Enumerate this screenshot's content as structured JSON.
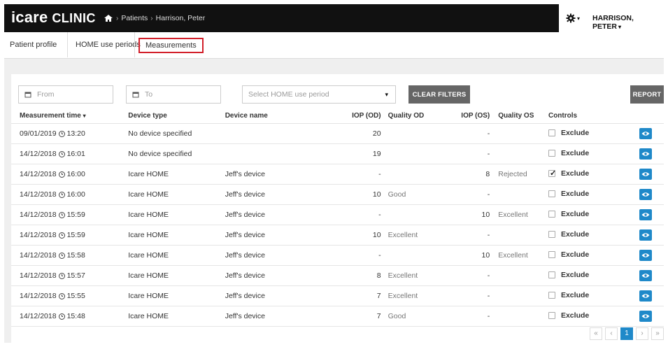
{
  "brand": {
    "part1": "icare",
    "part2": "CLINIC"
  },
  "breadcrumb": {
    "items": [
      "Patients",
      "Harrison, Peter"
    ],
    "separator": "›"
  },
  "user": {
    "name": "HARRISON, PETER"
  },
  "tabs": [
    "Patient profile",
    "HOME use periods",
    "Measurements"
  ],
  "filters": {
    "from_placeholder": "From",
    "to_placeholder": "To",
    "period_placeholder": "Select HOME use period",
    "clear_label": "CLEAR FILTERS",
    "report_label": "REPORT"
  },
  "table": {
    "headers": {
      "time": "Measurement time",
      "device_type": "Device type",
      "device_name": "Device name",
      "iop_od": "IOP (OD)",
      "quality_od": "Quality OD",
      "iop_os": "IOP (OS)",
      "quality_os": "Quality OS",
      "controls": "Controls"
    },
    "exclude_label": "Exclude",
    "rows": [
      {
        "date": "09/01/2019",
        "time": "13:20",
        "device_type": "No device specified",
        "device_name": "",
        "iop_od": "20",
        "quality_od": "",
        "iop_os": "-",
        "quality_os": "",
        "excluded": false
      },
      {
        "date": "14/12/2018",
        "time": "16:01",
        "device_type": "No device specified",
        "device_name": "",
        "iop_od": "19",
        "quality_od": "",
        "iop_os": "-",
        "quality_os": "",
        "excluded": false
      },
      {
        "date": "14/12/2018",
        "time": "16:00",
        "device_type": "Icare HOME",
        "device_name": "Jeff's device",
        "iop_od": "-",
        "quality_od": "",
        "iop_os": "8",
        "quality_os": "Rejected",
        "excluded": true
      },
      {
        "date": "14/12/2018",
        "time": "16:00",
        "device_type": "Icare HOME",
        "device_name": "Jeff's device",
        "iop_od": "10",
        "quality_od": "Good",
        "iop_os": "-",
        "quality_os": "",
        "excluded": false
      },
      {
        "date": "14/12/2018",
        "time": "15:59",
        "device_type": "Icare HOME",
        "device_name": "Jeff's device",
        "iop_od": "-",
        "quality_od": "",
        "iop_os": "10",
        "quality_os": "Excellent",
        "excluded": false
      },
      {
        "date": "14/12/2018",
        "time": "15:59",
        "device_type": "Icare HOME",
        "device_name": "Jeff's device",
        "iop_od": "10",
        "quality_od": "Excellent",
        "iop_os": "-",
        "quality_os": "",
        "excluded": false
      },
      {
        "date": "14/12/2018",
        "time": "15:58",
        "device_type": "Icare HOME",
        "device_name": "Jeff's device",
        "iop_od": "-",
        "quality_od": "",
        "iop_os": "10",
        "quality_os": "Excellent",
        "excluded": false
      },
      {
        "date": "14/12/2018",
        "time": "15:57",
        "device_type": "Icare HOME",
        "device_name": "Jeff's device",
        "iop_od": "8",
        "quality_od": "Excellent",
        "iop_os": "-",
        "quality_os": "",
        "excluded": false
      },
      {
        "date": "14/12/2018",
        "time": "15:55",
        "device_type": "Icare HOME",
        "device_name": "Jeff's device",
        "iop_od": "7",
        "quality_od": "Excellent",
        "iop_os": "-",
        "quality_os": "",
        "excluded": false
      },
      {
        "date": "14/12/2018",
        "time": "15:48",
        "device_type": "Icare HOME",
        "device_name": "Jeff's device",
        "iop_od": "7",
        "quality_od": "Good",
        "iop_os": "-",
        "quality_os": "",
        "excluded": false
      }
    ]
  },
  "pagination": {
    "first": "«",
    "prev": "‹",
    "current": "1",
    "next": "›",
    "last": "»"
  },
  "colors": {
    "accent": "#1f89c9",
    "tab_highlight": "#d21f2a",
    "header_bg": "#111111",
    "button_bg": "#666666"
  }
}
